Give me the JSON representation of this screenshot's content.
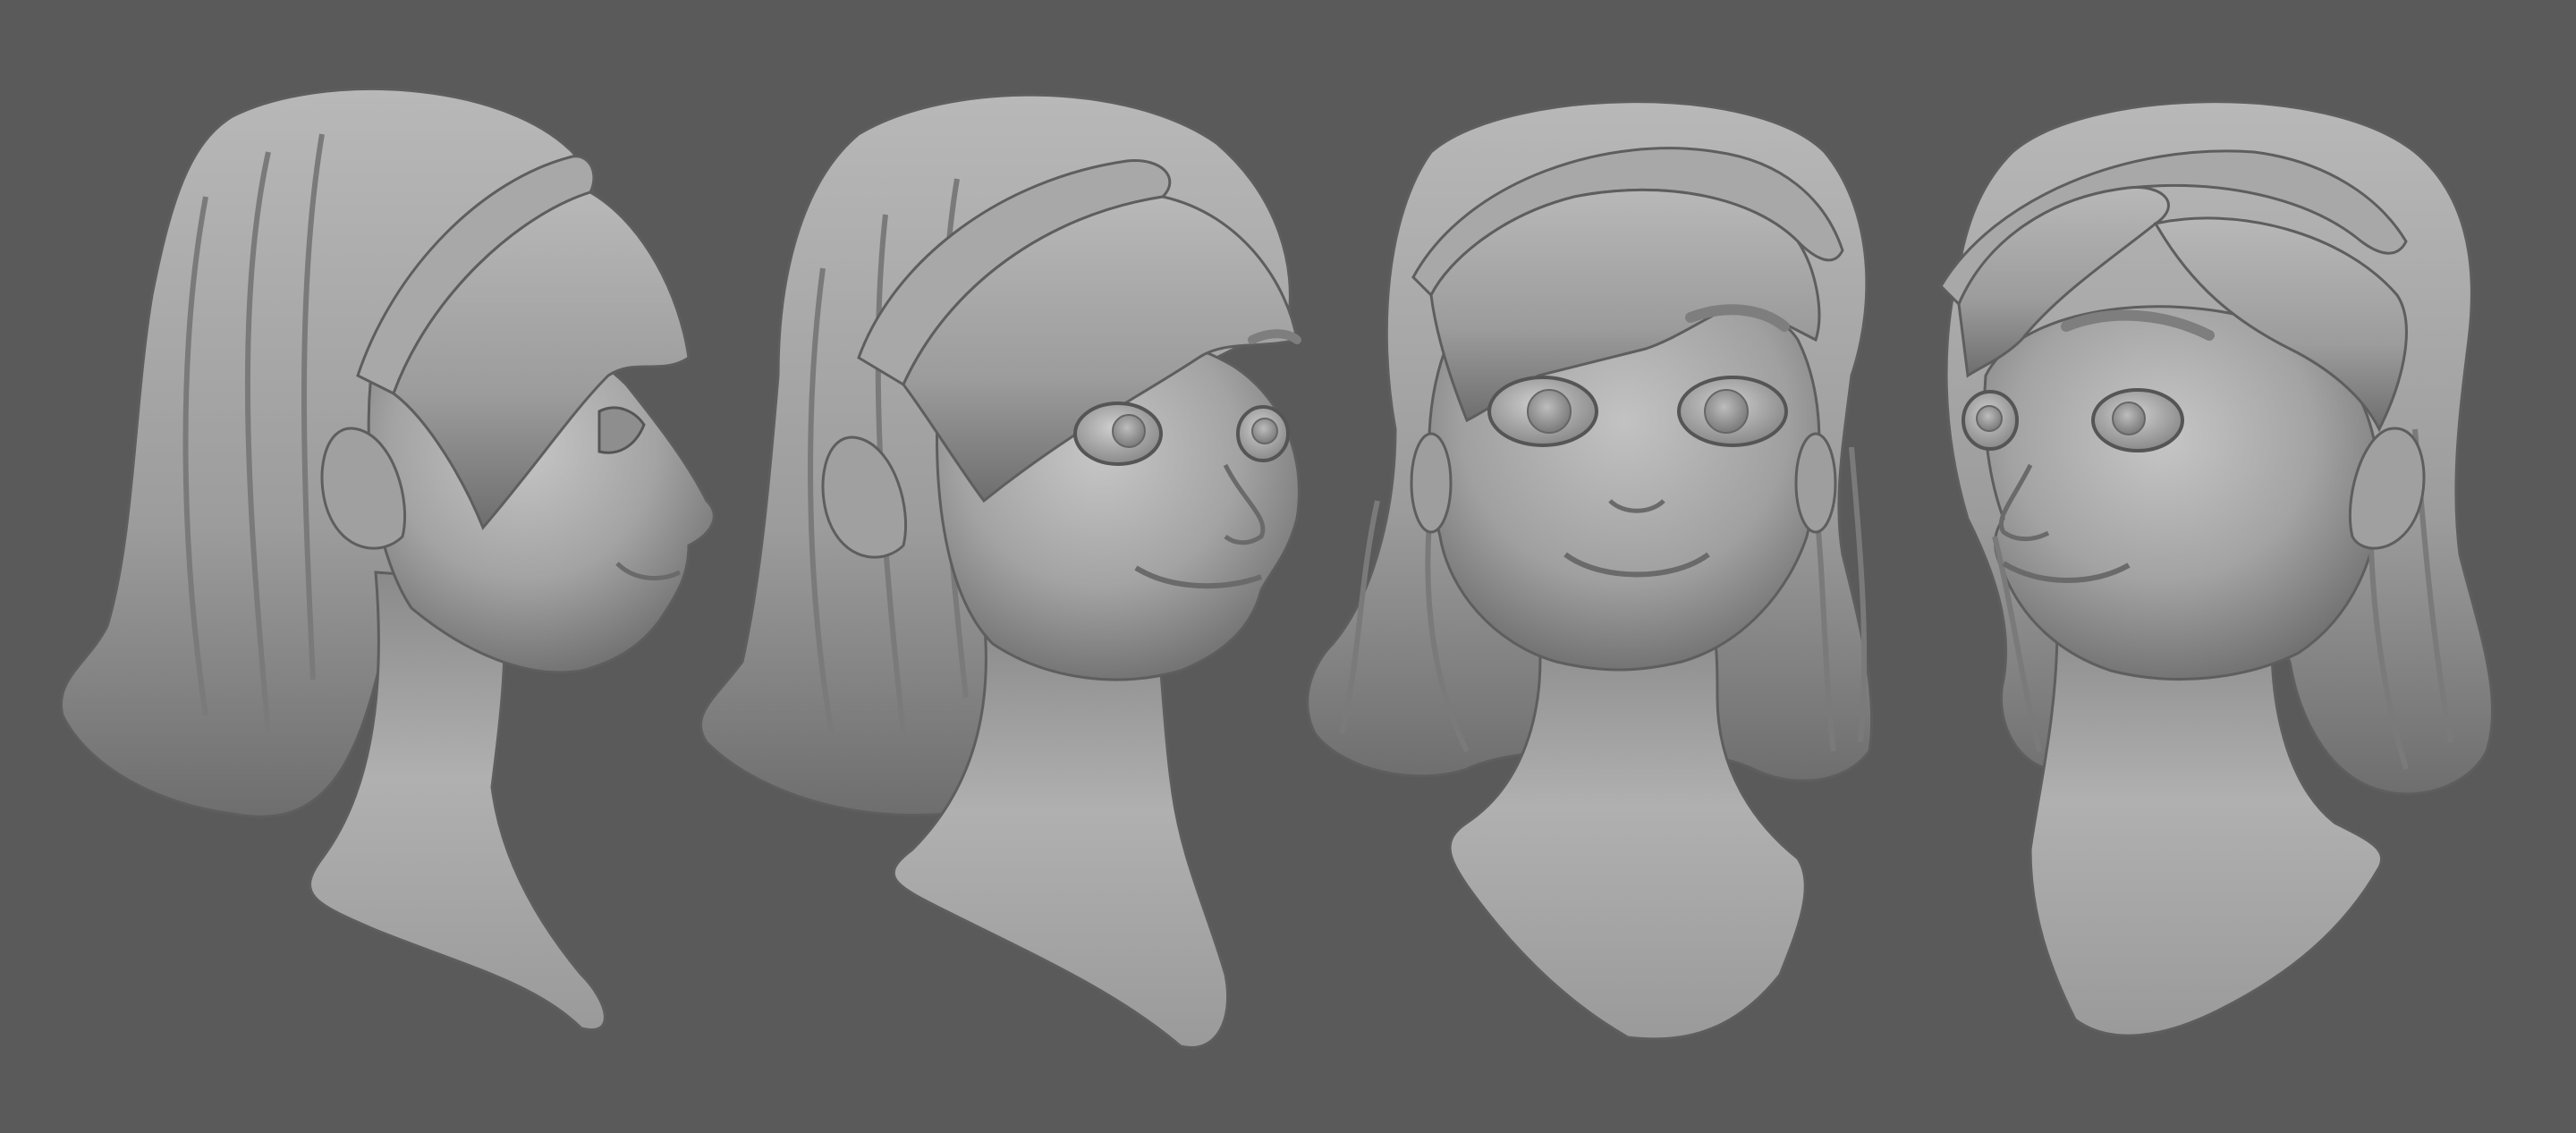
{
  "scene": {
    "subject": "cartoon-girl-head-sculpt",
    "views": [
      {
        "id": "view-profile-right",
        "angle": "side"
      },
      {
        "id": "view-three-quarter-right",
        "angle": "three-quarter"
      },
      {
        "id": "view-front",
        "angle": "front"
      },
      {
        "id": "view-three-quarter-left",
        "angle": "three-quarter"
      }
    ]
  },
  "colors": {
    "background": "#5a5a5a",
    "clay_light": "#bdbdbd",
    "clay_mid": "#9a9a9a",
    "clay_dark": "#6e6e6e",
    "clay_shadow": "#545454"
  }
}
